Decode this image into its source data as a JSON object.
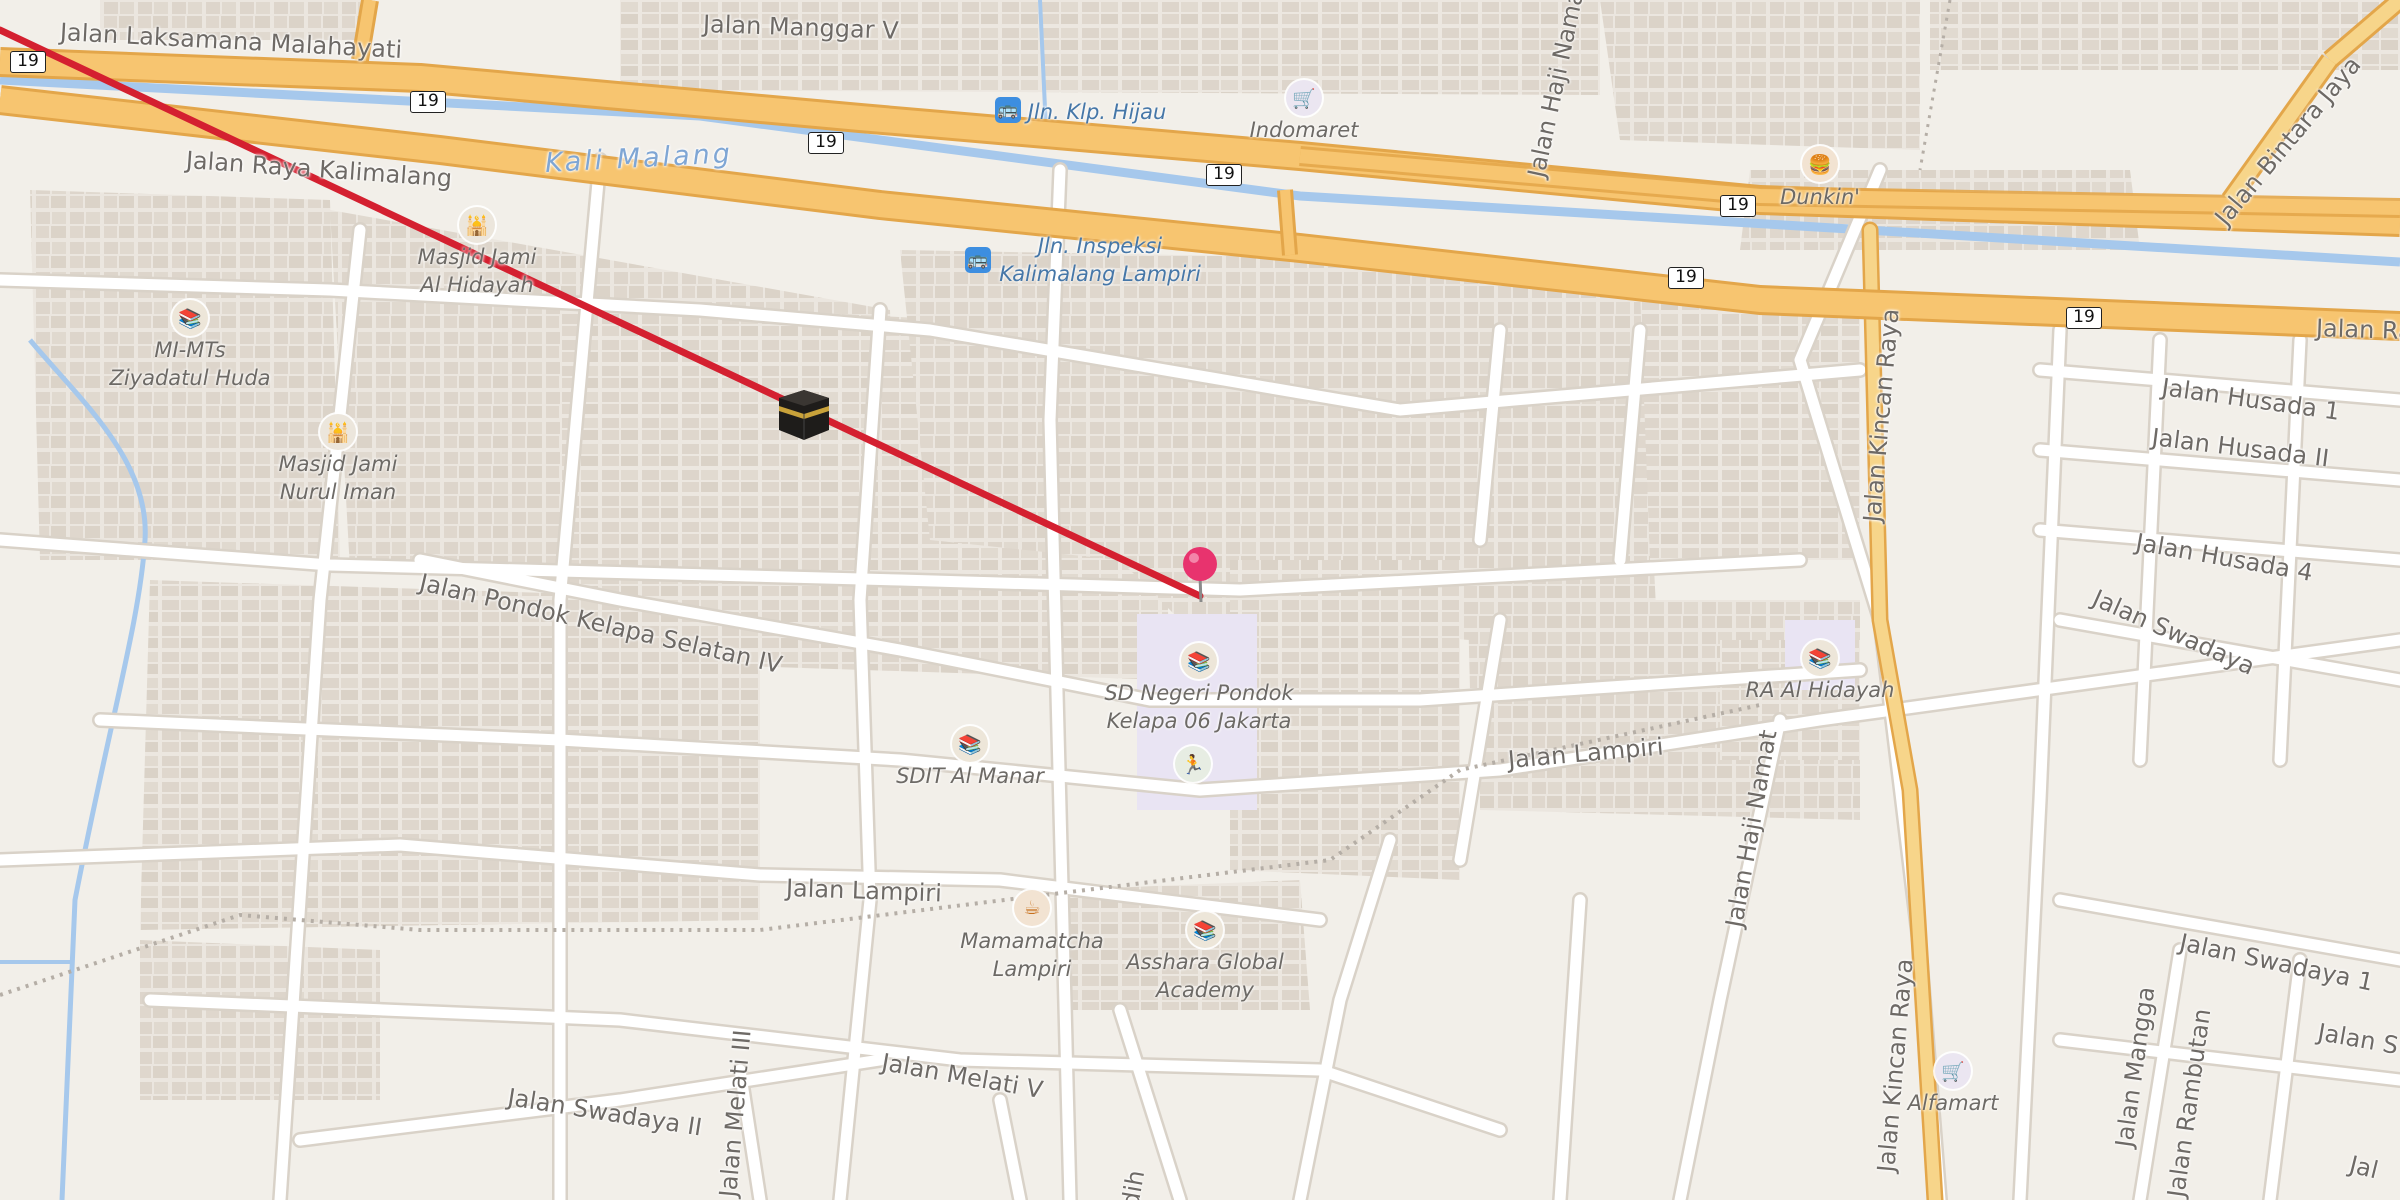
{
  "map": {
    "colors": {
      "background": "#f2efe9",
      "building": "#e0d9d0",
      "minor_road": "#ffffff",
      "road_casing": "#d9d2c8",
      "highway_fill": "#f7c570",
      "highway_casing": "#e3a64a",
      "water": "#a6c8ec",
      "qibla_line": "#d42030",
      "pin": "#e8336e",
      "school_area": "#e9e4f3"
    },
    "highway_shields": [
      "19",
      "19",
      "19",
      "19",
      "19",
      "19",
      "19"
    ],
    "road_labels": [
      "Jalan Laksamana Malahayati",
      "Jalan Manggar V",
      "Jalan Raya Kalimalang",
      "Jalan Haji Namat",
      "Jalan Bintara Jaya",
      "Jalan Ra",
      "Jalan Husada 1",
      "Jalan Husada II",
      "Jalan Husada 4",
      "Jalan Swadaya",
      "Jalan Kincan Raya",
      "Jalan Pondok Kelapa Selatan IV",
      "Jalan Lampiri",
      "Jalan Lampiri",
      "Jalan Haji Namat",
      "Jalan Kincan Raya",
      "Jalan Swadaya 1",
      "Jalan S",
      "Jalan Melati V",
      "Jalan Swadaya II",
      "Jalan Melati III",
      "Jalan Mangga",
      "Jalan Rambutan",
      "Jal",
      "dih"
    ],
    "water_label": "Kali Malang",
    "bus_stops": [
      "Jln. Klp. Hijau",
      "Jln. Inspeksi\nKalimalang Lampiri"
    ],
    "pois": [
      {
        "name": "Indomaret",
        "icon": "shop-basket-icon"
      },
      {
        "name": "Dunkin'",
        "icon": "burger-icon"
      },
      {
        "name": "Masjid Jami\nAl Hidayah",
        "icon": "mosque-icon"
      },
      {
        "name": "MI-MTs\nZiyadatul Huda",
        "icon": "school-icon"
      },
      {
        "name": "Masjid Jami\nNurul Iman",
        "icon": "mosque-icon"
      },
      {
        "name": "SD Negeri Pondok\nKelapa 06 Jakarta",
        "icon": "school-icon"
      },
      {
        "name": "RA Al Hidayah",
        "icon": "school-icon"
      },
      {
        "name": "SDIT Al Manar",
        "icon": "school-icon"
      },
      {
        "name": "Mamamatcha\nLampiri",
        "icon": "cafe-icon"
      },
      {
        "name": "Asshara Global\nAcademy",
        "icon": "school-icon"
      },
      {
        "name": "Alfamart",
        "icon": "shop-basket-icon"
      }
    ],
    "markers": {
      "kaaba": "kaaba-icon",
      "location": "location-pin-icon",
      "sports": "running-person-icon"
    }
  }
}
